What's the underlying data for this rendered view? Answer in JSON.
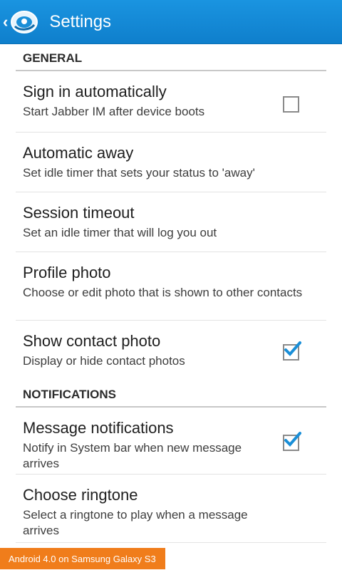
{
  "actionbar": {
    "title": "Settings",
    "up_icon": "chevron-left-icon",
    "logo_icon": "jabber-logo-icon",
    "color": "#1788d8"
  },
  "sections": [
    {
      "header": "GENERAL",
      "items": [
        {
          "title": "Sign in automatically",
          "summary": "Start Jabber IM after device boots",
          "checkbox": true,
          "checked": false
        },
        {
          "title": "Automatic away",
          "summary": "Set idle timer that sets your status to 'away'",
          "checkbox": false
        },
        {
          "title": "Session timeout",
          "summary": "Set an idle timer that will log you out",
          "checkbox": false
        },
        {
          "title": "Profile photo",
          "summary": "Choose or edit photo that is shown to other contacts",
          "checkbox": false
        },
        {
          "title": "Show contact photo",
          "summary": "Display or hide contact photos",
          "checkbox": true,
          "checked": true
        }
      ]
    },
    {
      "header": "NOTIFICATIONS",
      "items": [
        {
          "title": "Message notifications",
          "summary": "Notify in System bar when new message arrives",
          "checkbox": true,
          "checked": true
        },
        {
          "title": "Choose ringtone",
          "summary": "Select a ringtone to play when a message arrives",
          "checkbox": false
        }
      ]
    }
  ],
  "overlay": {
    "device_label": "Android 4.0 on Samsung Galaxy S3",
    "color": "#f07d1b"
  },
  "accent": "#1a8fd8"
}
